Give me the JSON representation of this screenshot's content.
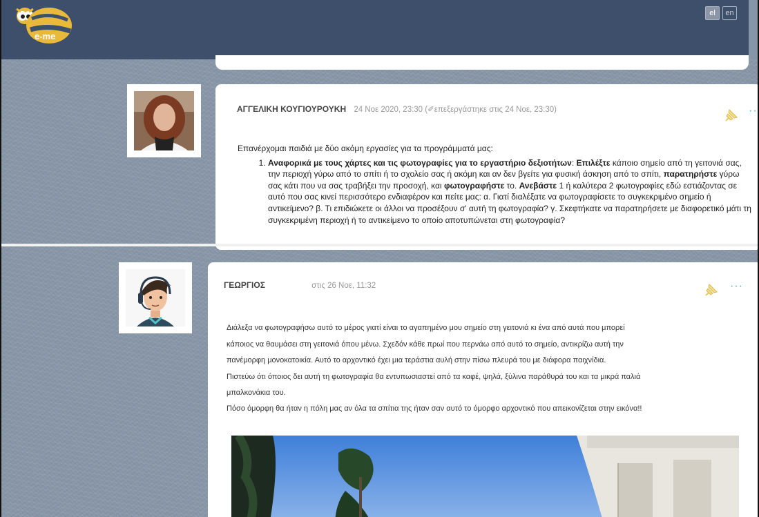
{
  "header": {
    "logo_text": "e-me",
    "lang_el": "el",
    "lang_en": "en"
  },
  "post1": {
    "author": "ΑΓΓΕΛΙΚΗ ΚΟΥΓΙΟΥΡΟΥΚΗ",
    "date": "24 Νοε 2020, 23:30",
    "edited": "(✐επεξεργάστηκε στις 24 Νοε, 23:30)",
    "intro": "Επανέρχομαι παιδιά με δύο ακόμη εργασίες για τα προγράμματά μας:",
    "item1": {
      "t1": "Αναφορικά με τους χάρτες και τις φωτογραφίες για το εργαστήριο δεξιοτήτων",
      "t2": ": ",
      "t3": "Επιλέξτε",
      "t4": " κάποιο σημείο από τη γειτονιά σας, την περιοχή γύρω από το σπίτι ή το σχολείο σας ή ακόμη και αν δεν βγείτε για φυσική άσκηση από το σπίτι, ",
      "t5": "παρατηρήστε",
      "t6": " γύρω σας κάτι που να σας τραβήξει την προσοχή, και ",
      "t7": "φωτογραφήστε",
      "t8": " το. ",
      "t9": "Ανεβάστε",
      "t10": " 1 ή καλύτερα 2 φωτογραφίες εδώ εστιάζοντας σε αυτό που σας κινεί περισσότερο ενδιαφέρον και πείτε μας: α. Γιατί διαλέξατε να φωτογραφίσετε το συγκεκριμένο σημείο ή αντικείμενο? β. Τι επιδιώκετε οι άλλοι να προσέξουν σ' αυτή τη φωτογραφία? γ. Σκεφτήκατε να παρατηρήσετε με διαφορετικό μάτι τη συγκεκριμένη περιοχή ή το αντικείμενο το οποίο αποτυπώνεται στη φωτογραφία?"
    }
  },
  "post2": {
    "author": "ΓΕΩΡΓΙΟΣ",
    "date": "στις 26 Νοε, 11:32",
    "lines": [
      "Διάλεξα να φωτογραφήσω αυτό το μέρος γιατί είναι το αγαπημένο μου σημείο στη γειτονιά  κι ένα από αυτά που μπορεί",
      "κάποιος να θαυμάσει στη γειτονιά όπου μένω. Σχεδόν κάθε πρωί που περνάω από αυτό το σημείο, αντικρίζω αυτή την",
      "πανέμορφη μονοκατοικία. Αυτό το αρχοντικό έχει μια τεράστια αυλή στην πίσω πλευρά του με διάφορα παιχνίδια.",
      "Πιστεύω ότι όποιος δει αυτή τη φωτογραφία θα εντυπωσιαστεί από τα καφέ, ψηλά, ξύλινα παράθυρά του και τα μικρά παλιά",
      "μπαλκονάκια του.",
      "Πόσο όμορφη θα ήταν η πόλη μας αν όλα τα σπίτια της ήταν σαν αυτό το όμορφο αρχοντικό που απεικονίζεται στην εικόνα!!"
    ]
  },
  "icons": {
    "pin": "pushpin-icon",
    "more": "more-options-icon",
    "more_glyph": "···"
  },
  "colors": {
    "header_bg": "#3e4f6c",
    "page_bg": "#8796a6",
    "accent": "#4db6ac"
  }
}
